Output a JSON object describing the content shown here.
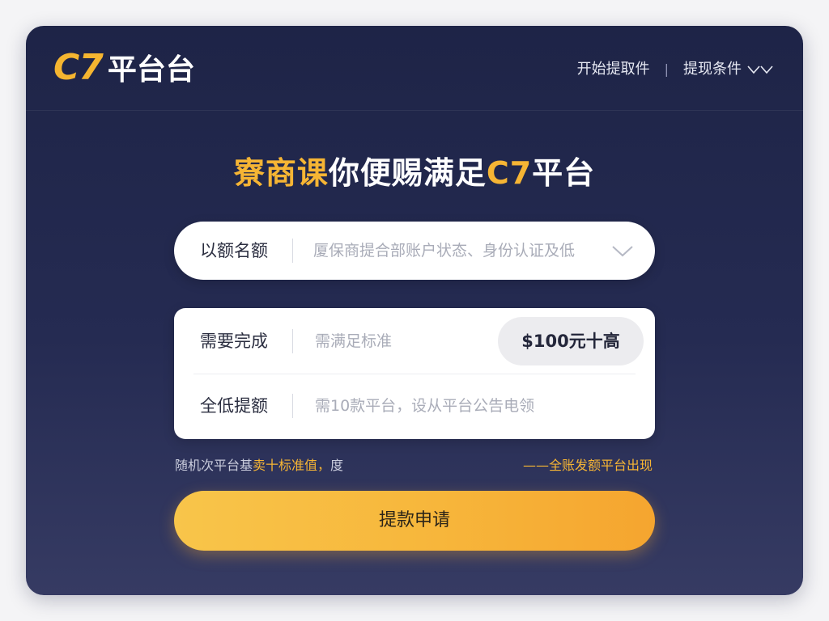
{
  "header": {
    "logo_mark": "C7",
    "logo_text": "平台台",
    "nav": {
      "start_label": "开始提取件",
      "separator": "|",
      "conditions_label": "提现条件"
    }
  },
  "main": {
    "title_highlight": "寮商课",
    "title_middle": "你便赐满足",
    "title_brand": "C7",
    "title_end": "平台"
  },
  "select_row": {
    "label": "以额名额",
    "value": "厦保商提合部账户状态、身份认证及低"
  },
  "form": {
    "rows": [
      {
        "label": "需要完成",
        "value": "需满足标准"
      },
      {
        "label": "全低提额",
        "value": "需10款平台，设从平台公告电领"
      }
    ],
    "amount_chip": "$100元十高"
  },
  "notices": {
    "left_prefix": "随机次平台基",
    "left_highlight": "卖十标准值，",
    "left_suffix": "度",
    "right": "——全账发额平台出现"
  },
  "submit": {
    "label": "提款申请"
  },
  "colors": {
    "accent": "#f6b534",
    "card_bg": "#1e2447",
    "button_start": "#f8c54a",
    "button_end": "#f5a52f"
  }
}
